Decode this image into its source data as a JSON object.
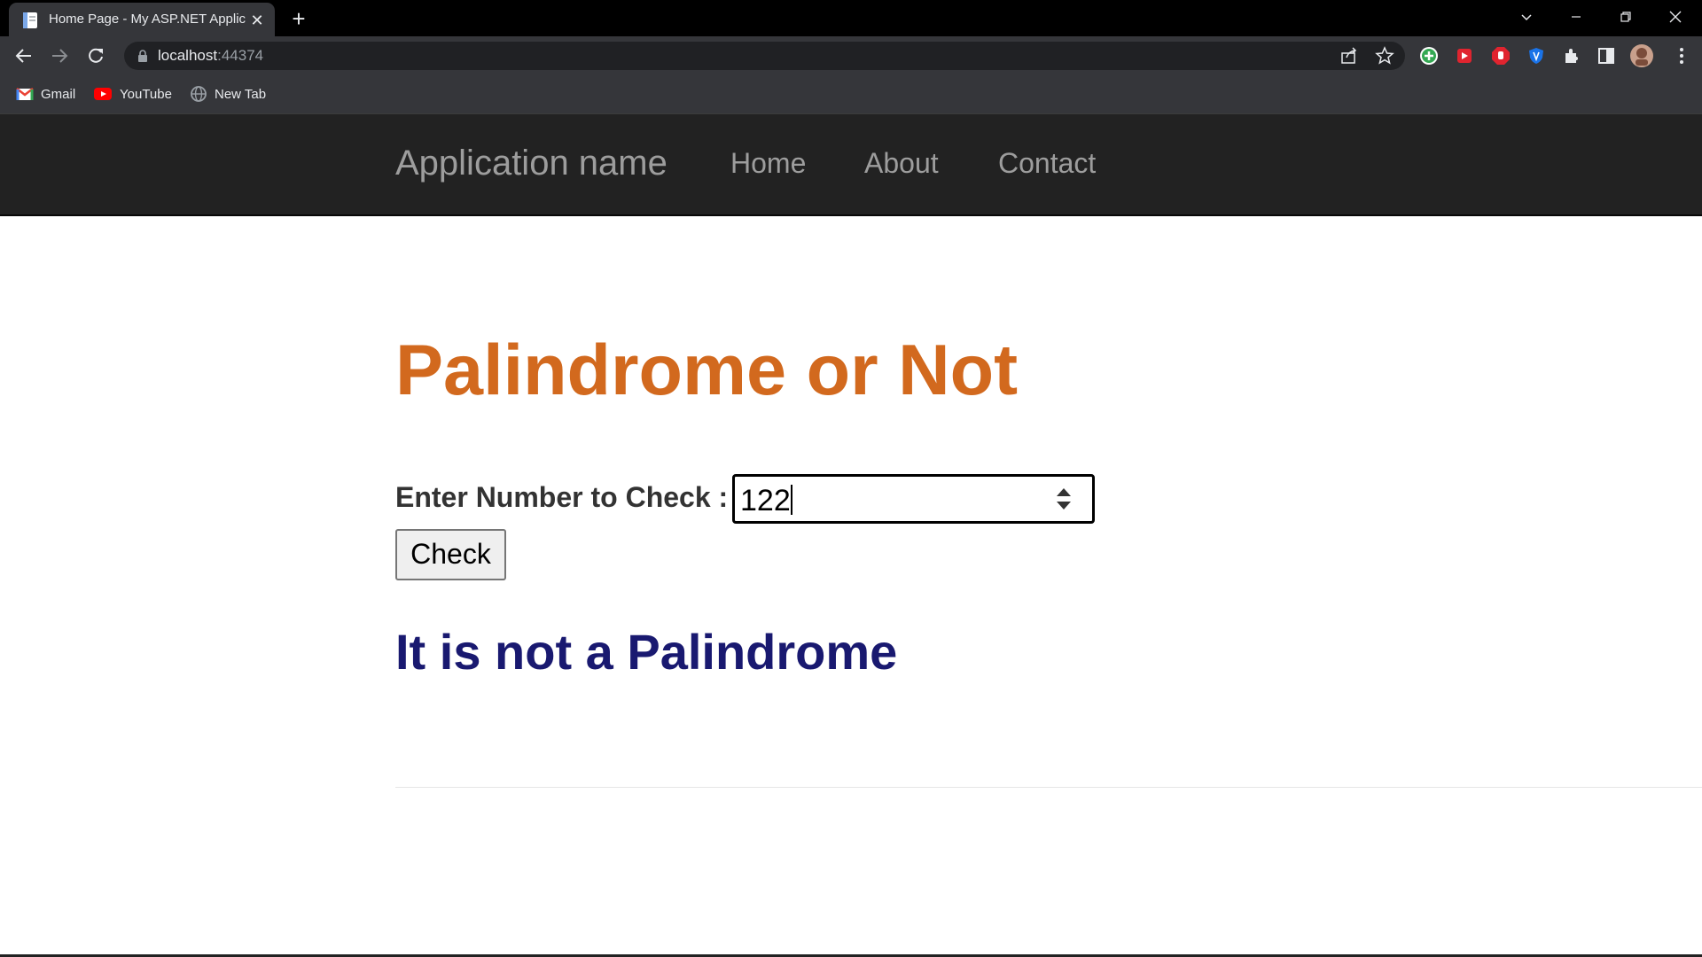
{
  "browser": {
    "tab_title": "Home Page - My ASP.NET Applic",
    "new_tab_symbol": "+",
    "close_tab_symbol": "✕",
    "url_host": "localhost",
    "url_port": ":44374",
    "bookmarks": [
      {
        "label": "Gmail",
        "icon": "gmail-icon"
      },
      {
        "label": "YouTube",
        "icon": "youtube-icon"
      },
      {
        "label": "New Tab",
        "icon": "globe-icon"
      }
    ],
    "toolbar_icons": [
      "share-icon",
      "bookmark-star-icon",
      "extension-green-plus-icon",
      "extension-red-play-icon",
      "adblock-icon",
      "shield-extension-icon",
      "extensions-puzzle-icon",
      "side-panel-icon",
      "profile-avatar",
      "menu-kebab-icon"
    ],
    "colors": {
      "frame": "#000000",
      "toolbar": "#35363a",
      "omnibox": "#202124"
    }
  },
  "site": {
    "brand": "Application name",
    "nav": [
      "Home",
      "About",
      "Contact"
    ],
    "navbar_color": "#222222"
  },
  "main": {
    "title": "Palindrome or Not",
    "title_color": "#d2691e",
    "input_label": "Enter Number to Check :",
    "input_value": "122",
    "button_label": "Check",
    "result": "It is not a Palindrome",
    "result_color": "#191970"
  }
}
